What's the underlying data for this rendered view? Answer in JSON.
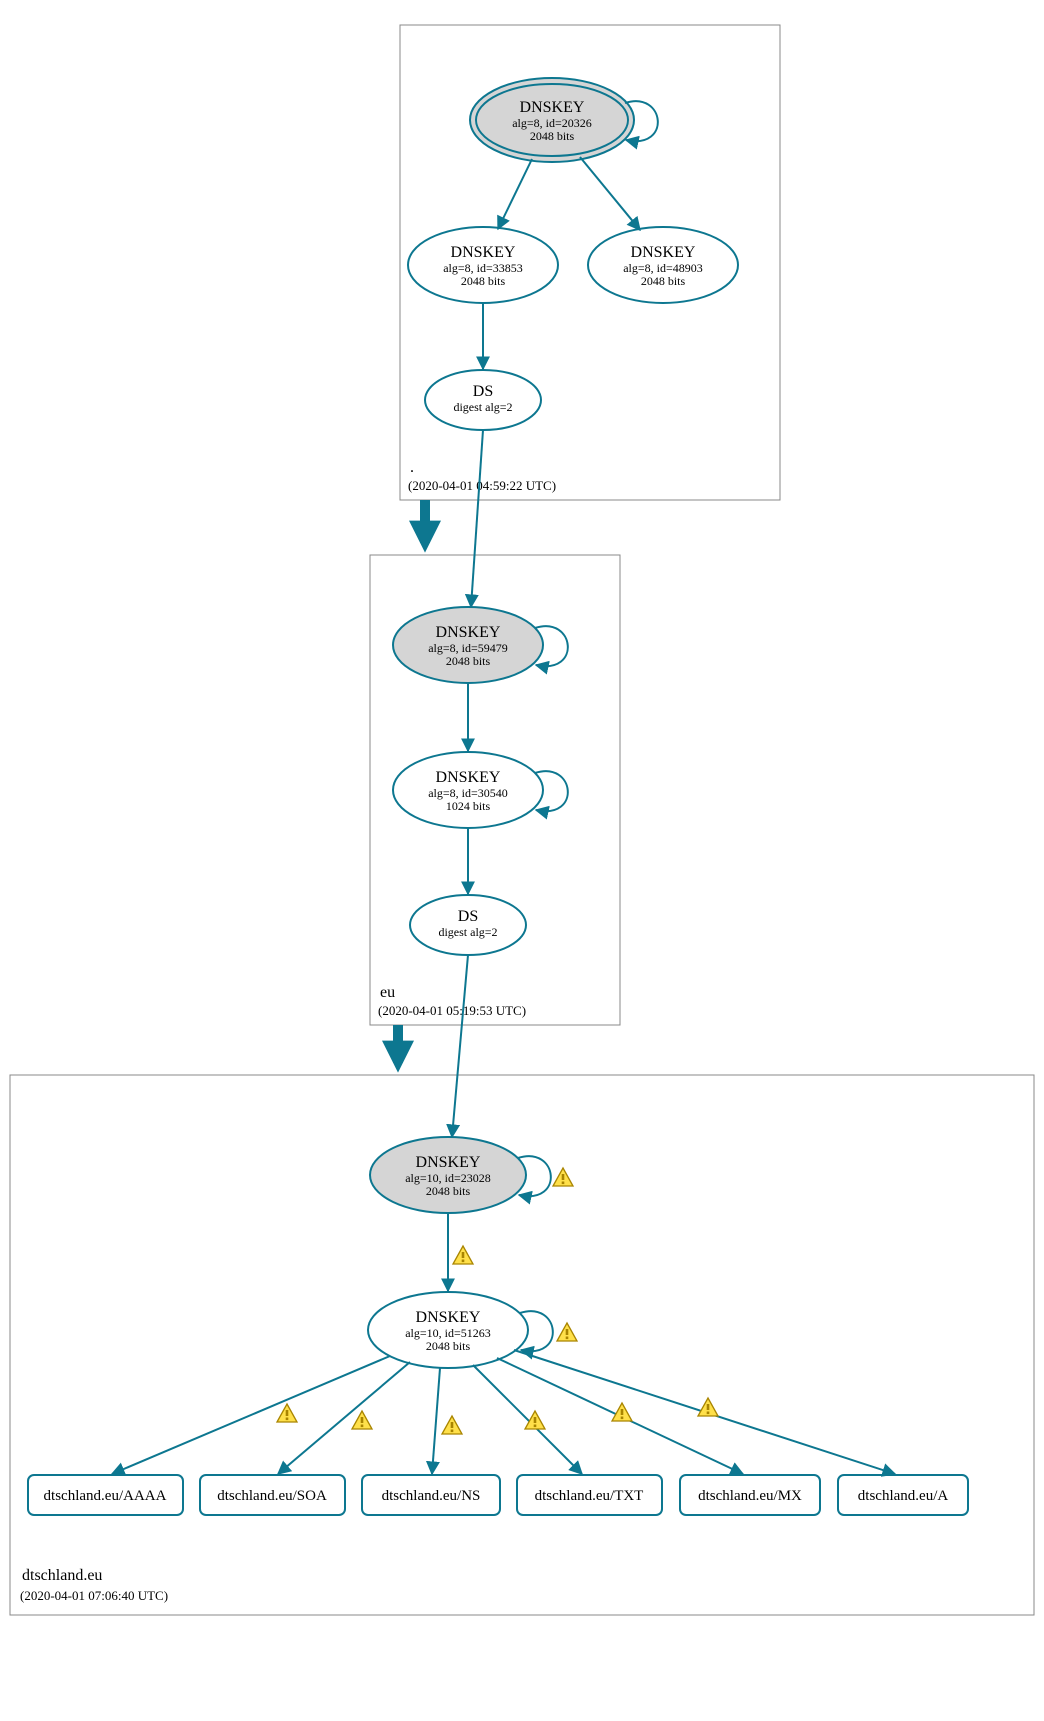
{
  "zones": {
    "root": {
      "label": ".",
      "time": "(2020-04-01 04:59:22 UTC)",
      "dnskey1": {
        "title": "DNSKEY",
        "line1": "alg=8, id=20326",
        "line2": "2048 bits"
      },
      "dnskey2": {
        "title": "DNSKEY",
        "line1": "alg=8, id=33853",
        "line2": "2048 bits"
      },
      "dnskey3": {
        "title": "DNSKEY",
        "line1": "alg=8, id=48903",
        "line2": "2048 bits"
      },
      "ds": {
        "title": "DS",
        "line1": "digest alg=2"
      }
    },
    "eu": {
      "label": "eu",
      "time": "(2020-04-01 05:19:53 UTC)",
      "dnskey1": {
        "title": "DNSKEY",
        "line1": "alg=8, id=59479",
        "line2": "2048 bits"
      },
      "dnskey2": {
        "title": "DNSKEY",
        "line1": "alg=8, id=30540",
        "line2": "1024 bits"
      },
      "ds": {
        "title": "DS",
        "line1": "digest alg=2"
      }
    },
    "domain": {
      "label": "dtschland.eu",
      "time": "(2020-04-01 07:06:40 UTC)",
      "dnskey1": {
        "title": "DNSKEY",
        "line1": "alg=10, id=23028",
        "line2": "2048 bits"
      },
      "dnskey2": {
        "title": "DNSKEY",
        "line1": "alg=10, id=51263",
        "line2": "2048 bits"
      },
      "rrsets": {
        "aaaa": "dtschland.eu/AAAA",
        "soa": "dtschland.eu/SOA",
        "ns": "dtschland.eu/NS",
        "txt": "dtschland.eu/TXT",
        "mx": "dtschland.eu/MX",
        "a": "dtschland.eu/A"
      }
    }
  }
}
